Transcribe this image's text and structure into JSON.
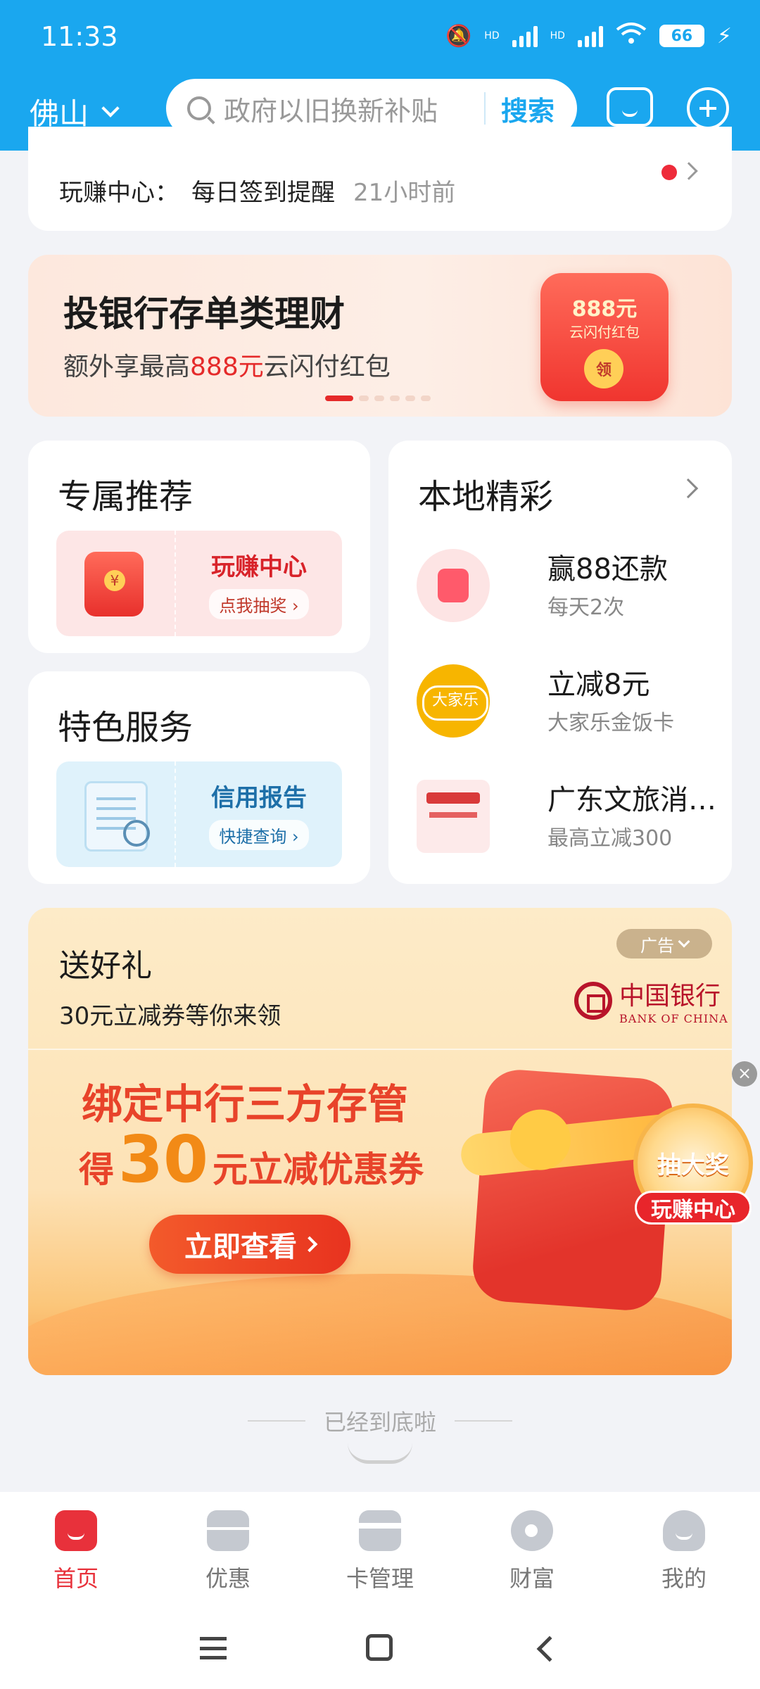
{
  "status_bar": {
    "time": "11:33",
    "battery": "66",
    "hd1": "HD",
    "hd2": "HD"
  },
  "header": {
    "city": "佛山",
    "search_placeholder": "政府以旧换新补贴",
    "search_button": "搜索"
  },
  "notifications": [
    {
      "key": "玩赚中心：",
      "value": "每日签到提醒",
      "time": "21小时前"
    }
  ],
  "banner": {
    "title": "投银行存单类理财",
    "subtitle_prefix": "额外享最高",
    "subtitle_highlight": "888元",
    "subtitle_suffix": "云闪付红包",
    "pack_amount": "888元",
    "pack_label": "云闪付红包",
    "pack_seal": "领"
  },
  "exclusive": {
    "title": "专属推荐",
    "promo_title": "玩赚中心",
    "promo_action": "点我抽奖 ›"
  },
  "special": {
    "title": "特色服务",
    "promo_title": "信用报告",
    "promo_action": "快捷查询 ›"
  },
  "local": {
    "title": "本地精彩",
    "items": [
      {
        "title": "赢88还款",
        "desc": "每天2次"
      },
      {
        "title": "立减8元",
        "desc": "大家乐金饭卡"
      },
      {
        "title": "广东文旅消…",
        "desc": "最高立减300"
      }
    ]
  },
  "ad": {
    "title": "送好礼",
    "subtitle": "30元立减券等你来领",
    "tag": "广告",
    "brand_cn": "中国银行",
    "brand_en": "BANK OF CHINA",
    "headline1": "绑定中行三方存管",
    "headline2_prefix": "得",
    "headline2_number": "30",
    "headline2_suffix": "元立减优惠券",
    "cta": "立即查看"
  },
  "floating": {
    "close": "×",
    "title": "抽大奖",
    "label": "玩赚中心"
  },
  "bottom_note": "已经到底啦",
  "tabs": [
    {
      "label": "首页",
      "icon": "home-icon"
    },
    {
      "label": "优惠",
      "icon": "coupon-icon"
    },
    {
      "label": "卡管理",
      "icon": "card-icon"
    },
    {
      "label": "财富",
      "icon": "wealth-icon"
    },
    {
      "label": "我的",
      "icon": "profile-icon"
    }
  ],
  "colors": {
    "header_blue": "#1aa7ef",
    "accent_red": "#e8313b"
  }
}
